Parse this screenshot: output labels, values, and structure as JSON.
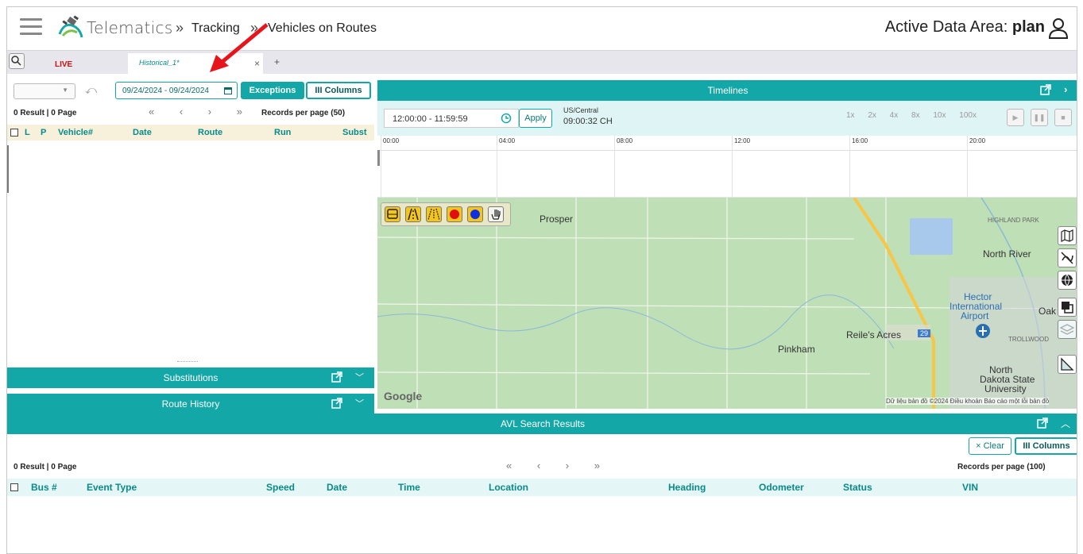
{
  "header": {
    "brand": "Telematics",
    "sep": "»",
    "crumb1": "Tracking",
    "crumb2": "Vehicles on Routes",
    "area_label": "Active Data Area: ",
    "area_value": "plan"
  },
  "tabs": {
    "live": "LIVE",
    "historical": "Historical_1*",
    "close": "×",
    "add": "+"
  },
  "left": {
    "date_range": "09/24/2024 - 09/24/2024",
    "exceptions": "Exceptions",
    "columns": "III Columns",
    "result": "0 Result | 0 Page",
    "pager": "« ‹ › »",
    "records": "Records per page (50)",
    "columns_list": [
      "L",
      "P",
      "Vehicle#",
      "Date",
      "Route",
      "Run",
      "Subst"
    ],
    "sub_bar": "Substitutions",
    "rh_bar": "Route History"
  },
  "timelines": {
    "title": "Timelines",
    "time_range": "12:00:00  -  11:59:59",
    "apply": "Apply",
    "tz": "US/Central",
    "tz_time": "09:00:32 CH",
    "speeds": "1x 2x 4x 8x 10x 100x",
    "ticks": [
      "00:00",
      "04:00",
      "08:00",
      "12:00",
      "16:00",
      "20:00"
    ]
  },
  "map": {
    "labels": {
      "prosper": "Prosper",
      "highland": "HIGHLAND PARK",
      "north_river": "North River",
      "hector": "Hector",
      "intl": "International",
      "airport": "Airport",
      "oak": "Oak",
      "reiles": "Reile's Acres",
      "trollwood": "TROLLWOOD",
      "pinkham": "Pinkham",
      "north": "North",
      "dakota": "Dakota State",
      "university": "University",
      "hwy": "29"
    },
    "google": "Google",
    "attribution": "Dữ liệu bản đồ ©2024   Điều khoản   Báo cáo một lỗi bản đồ"
  },
  "avl": {
    "title": "AVL Search Results",
    "clear": "× Clear",
    "columns": "III Columns",
    "result": "0 Result | 0 Page",
    "pager": "« ‹ › »",
    "records": "Records per page (100)",
    "columns_list": [
      "Bus #",
      "Event Type",
      "Speed",
      "Date",
      "Time",
      "Location",
      "Heading",
      "Odometer",
      "Status",
      "VIN"
    ]
  },
  "colors": {
    "accent": "#14a7a7",
    "live": "#d01010",
    "arrow": "#e8141c"
  }
}
